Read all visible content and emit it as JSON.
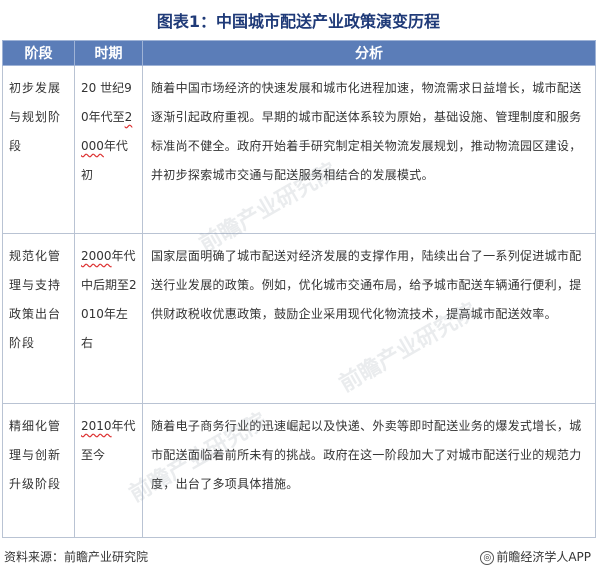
{
  "title": "图表1：中国城市配送产业政策演变历程",
  "headers": [
    "阶段",
    "时期",
    "分析"
  ],
  "rows": [
    {
      "stage": "初步发展与规划阶段",
      "period_parts": [
        "20 世纪90年代至",
        "2000",
        "年代初"
      ],
      "analysis": "随着中国市场经济的快速发展和城市化进程加速，物流需求日益增长，城市配送逐渐引起政府重视。早期的城市配送体系较为原始，基础设施、管理制度和服务标准尚不健全。政府开始着手研究制定相关物流发展规划，推动物流园区建设，并初步探索城市交通与配送服务相结合的发展模式。"
    },
    {
      "stage": "规范化管理与支持政策出台阶段",
      "period_parts": [
        "",
        "2000",
        "年代中后期至2010年左右"
      ],
      "analysis": "国家层面明确了城市配送对经济发展的支撑作用，陆续出台了一系列促进城市配送行业发展的政策。例如，优化城市交通布局，给予城市配送车辆通行便利，提供财政税收优惠政策，鼓励企业采用现代化物流技术，提高城市配送效率。"
    },
    {
      "stage": "精细化管理与创新升级阶段",
      "period_parts": [
        "",
        "2010",
        "年代至今"
      ],
      "analysis": "随着电子商务行业的迅速崛起以及快递、外卖等即时配送业务的爆发式增长，城市配送面临着前所未有的挑战。政府在这一阶段加大了对城市配送行业的规范力度，出台了多项具体措施。"
    }
  ],
  "watermark": "前瞻产业研究院",
  "footer": {
    "source": "资料来源：前瞻产业研究院",
    "logo_glyph": "◎",
    "brand": "前瞻经济学人APP"
  }
}
